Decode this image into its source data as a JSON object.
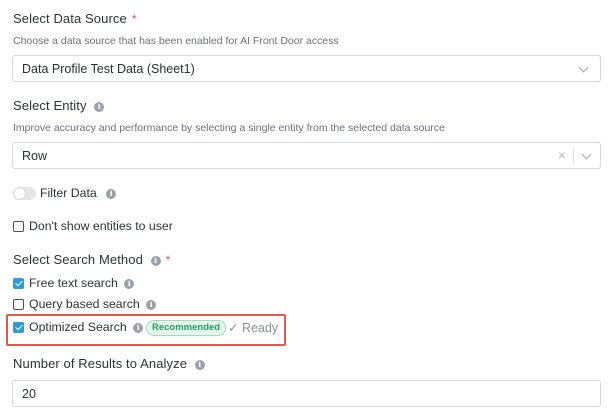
{
  "data_source": {
    "label": "Select Data Source",
    "required_mark": "*",
    "help": "Choose a data source that has been enabled for AI Front Door access",
    "selected": "Data Profile Test Data (Sheet1)"
  },
  "entity": {
    "label": "Select Entity",
    "help": "Improve accuracy and performance by selecting a single entity from the selected data source",
    "selected": "Row",
    "clear_glyph": "×"
  },
  "filter": {
    "label": "Filter Data",
    "enabled": false
  },
  "hide_entities": {
    "label": "Don't show entities to user",
    "checked": false
  },
  "search_method": {
    "label": "Select Search Method",
    "required_mark": "*",
    "options": [
      {
        "label": "Free text search",
        "checked": true
      },
      {
        "label": "Query based search",
        "checked": false
      },
      {
        "label": "Optimized Search",
        "checked": true,
        "badge": "Recommended",
        "status": "✓ Ready"
      }
    ]
  },
  "results": {
    "label": "Number of Results to Analyze",
    "value": "20"
  },
  "colors": {
    "accent": "#2f9ad3",
    "required": "#e0457b",
    "highlight": "#e05a48",
    "badge_text": "#23a05b"
  }
}
